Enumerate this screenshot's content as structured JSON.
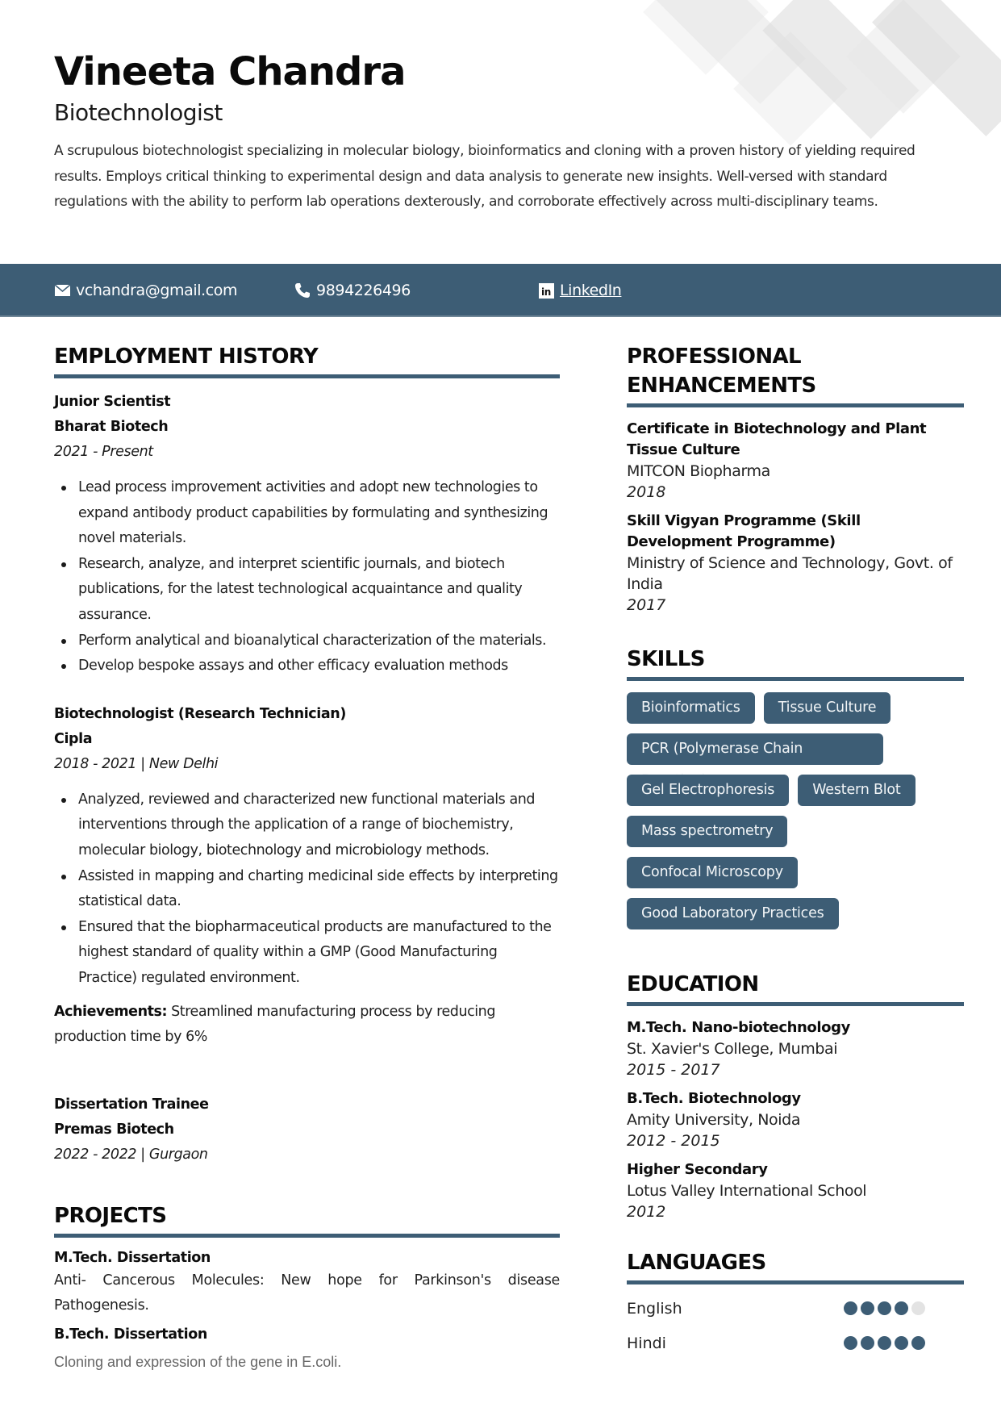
{
  "theme": {
    "accent": "#3d5d75",
    "dot_inactive": "#e3e3e3"
  },
  "header": {
    "name": "Vineeta Chandra",
    "title": "Biotechnologist",
    "summary": "A scrupulous biotechnologist specializing in molecular biology, bioinformatics and cloning with a proven history of yielding required results. Employs critical thinking to experimental design and data analysis to generate new insights. Well-versed with standard regulations with the ability to perform lab operations dexterously,  and corroborate effectively across multi-disciplinary teams."
  },
  "contact": {
    "email": {
      "icon": "envelope-icon",
      "text": "vchandra@gmail.com"
    },
    "phone": {
      "icon": "phone-icon",
      "text": "9894226496"
    },
    "linkedin": {
      "icon": "linkedin-icon",
      "text": "LinkedIn"
    }
  },
  "employment": {
    "heading": "EMPLOYMENT HISTORY",
    "jobs": [
      {
        "title": "Junior Scientist",
        "company": "Bharat Biotech",
        "date": "2021 - Present",
        "bullets": [
          "Lead process improvement activities and adopt new technologies to expand antibody product capabilities by formulating and synthesizing novel materials.",
          "Research, analyze, and interpret scientific journals, and biotech publications, for the latest technological acquaintance and quality assurance.",
          "Perform analytical and bioanalytical characterization of the materials.",
          "Develop bespoke assays and other efficacy evaluation methods"
        ]
      },
      {
        "title": "Biotechnologist (Research Technician)",
        "company": "Cipla",
        "date": "2018 - 2021 | New Delhi",
        "bullets": [
          "Analyzed, reviewed and characterized new functional materials and interventions through the application of a range of biochemistry, molecular biology, biotechnology and microbiology methods.",
          "Assisted in mapping and charting medicinal side effects by interpreting statistical data.",
          "Ensured that the biopharmaceutical products are manufactured to the highest standard of quality within a GMP (Good Manufacturing Practice) regulated environment."
        ],
        "achievements_label": "Achievements:",
        "achievements_text": " Streamlined manufacturing process by reducing production time by 6%"
      },
      {
        "title": "Dissertation Trainee",
        "company": "Premas Biotech",
        "date": "2022 - 2022 | Gurgaon"
      }
    ]
  },
  "projects": {
    "heading": "PROJECTS",
    "items": [
      {
        "title": "M.Tech. Dissertation",
        "description": "Anti- Cancerous Molecules: New hope for Parkinson's disease Pathogenesis."
      },
      {
        "title": "B.Tech. Dissertation",
        "description": "Cloning and expression of the gene in E.coli."
      }
    ]
  },
  "professional_enhancements": {
    "heading": "PROFESSIONAL ENHANCEMENTS",
    "items": [
      {
        "title": "Certificate in Biotechnology and Plant Tissue Culture",
        "org": "MITCON Biopharma",
        "date": "2018"
      },
      {
        "title": "Skill Vigyan Programme (Skill Development Programme)",
        "org": "Ministry of Science and Technology, Govt. of India",
        "date": "2017"
      }
    ]
  },
  "skills": {
    "heading": "SKILLS",
    "items": [
      "Bioinformatics",
      "Tissue Culture",
      "PCR (Polymerase Chain Reaction)",
      "Gel Electrophoresis",
      "Western Blot",
      "Mass spectrometry",
      "Confocal Microscopy",
      "Good Laboratory Practices"
    ]
  },
  "education": {
    "heading": "EDUCATION",
    "items": [
      {
        "degree": "M.Tech. Nano-biotechnology",
        "school": "St. Xavier's College, Mumbai",
        "date": "2015 - 2017"
      },
      {
        "degree": "B.Tech. Biotechnology",
        "school": "Amity University, Noida",
        "date": "2012 - 2015"
      },
      {
        "degree": "Higher Secondary",
        "school": "Lotus Valley International School",
        "date": "2012"
      }
    ]
  },
  "languages": {
    "heading": "LANGUAGES",
    "max_level": 5,
    "items": [
      {
        "name": "English",
        "level": 4
      },
      {
        "name": "Hindi",
        "level": 5
      }
    ]
  }
}
